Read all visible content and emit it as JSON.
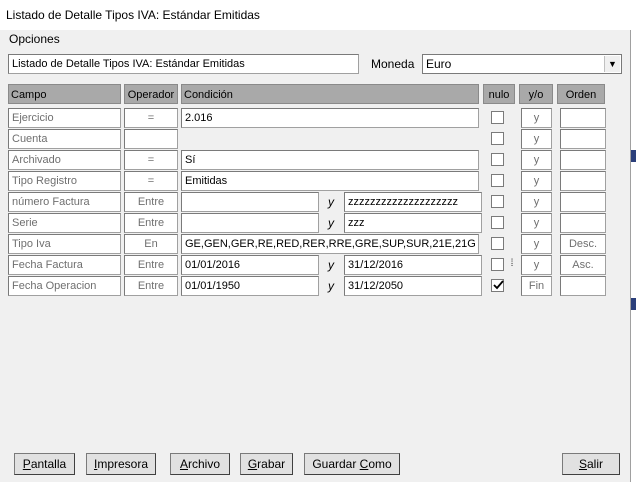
{
  "window": {
    "title": "Listado de Detalle Tipos IVA: Estándar Emitidas"
  },
  "menu": {
    "options_label": "Opciones"
  },
  "report": {
    "name_value": "Listado de Detalle Tipos IVA: Estándar Emitidas"
  },
  "currency": {
    "label": "Moneda",
    "selected": "Euro"
  },
  "headers": {
    "campo": "Campo",
    "operador": "Operador",
    "condicion": "Condición",
    "nulo": "nulo",
    "yo": "y/o",
    "orden": "Orden"
  },
  "rows": [
    {
      "campo": "Ejercicio",
      "operador": "=",
      "cond1": "2.016",
      "y": "",
      "cond2": "",
      "nulo": false,
      "yo": "y",
      "orden": ""
    },
    {
      "campo": "Cuenta",
      "operador": "",
      "cond1": "",
      "y": "",
      "cond2": "",
      "nulo": false,
      "yo": "y",
      "orden": ""
    },
    {
      "campo": "Archivado",
      "operador": "=",
      "cond1": "Sí",
      "y": "",
      "cond2": "",
      "nulo": false,
      "yo": "y",
      "orden": ""
    },
    {
      "campo": "Tipo Registro",
      "operador": "=",
      "cond1": "Emitidas",
      "y": "",
      "cond2": "",
      "nulo": false,
      "yo": "y",
      "orden": ""
    },
    {
      "campo": "número Factura",
      "operador": "Entre",
      "cond1": "",
      "y": "y",
      "cond2": "zzzzzzzzzzzzzzzzzzzz",
      "nulo": false,
      "yo": "y",
      "orden": ""
    },
    {
      "campo": "Serie",
      "operador": "Entre",
      "cond1": "",
      "y": "y",
      "cond2": "zzz",
      "nulo": false,
      "yo": "y",
      "orden": ""
    },
    {
      "campo": "Tipo Iva",
      "operador": "En",
      "cond1": "GE,GEN,GER,RE,RED,RER,RRE,GRE,SUP,SUR,21E,21G",
      "y": "",
      "cond2": "",
      "nulo": false,
      "yo": "y",
      "orden": "Desc."
    },
    {
      "campo": "Fecha Factura",
      "operador": "Entre",
      "cond1": "01/01/2016",
      "y": "y",
      "cond2": "31/12/2016",
      "nulo": false,
      "yo": "y",
      "orden": "Asc."
    },
    {
      "campo": "Fecha Operacion",
      "operador": "Entre",
      "cond1": "01/01/1950",
      "y": "y",
      "cond2": "31/12/2050",
      "nulo": true,
      "yo": "Fin",
      "orden": ""
    }
  ],
  "buttons": {
    "pantalla": "Pantalla",
    "impresora": "Impresora",
    "archivo": "Archivo",
    "grabar": "Grabar",
    "guardar_como": "Guardar Como",
    "salir": "Salir"
  }
}
